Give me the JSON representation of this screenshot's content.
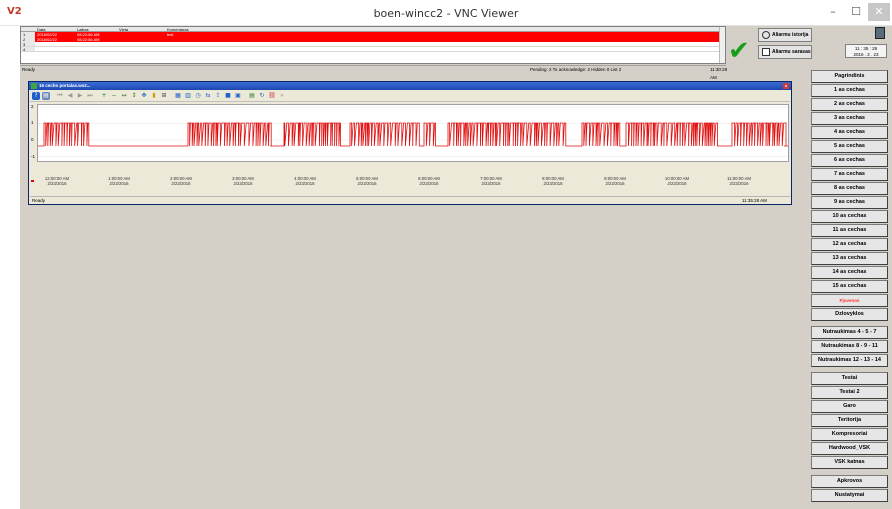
{
  "window": {
    "logo": "V2",
    "title": "boen-wincc2 - VNC Viewer",
    "min": "–",
    "max": "☐",
    "close": "✕"
  },
  "alarm_table": {
    "columns": [
      "Data",
      "Laikas",
      "Vieta",
      "Komentaras"
    ],
    "rows": [
      {
        "num": "1",
        "date": "2016/02/22",
        "time": "08:22:56 AM",
        "place": "",
        "comment": "test"
      },
      {
        "num": "2",
        "date": "2016/02/22",
        "time": "08:22:56 AM",
        "place": "",
        "comment": ""
      },
      {
        "num": "3",
        "date": "",
        "time": "",
        "place": "",
        "comment": ""
      },
      {
        "num": "4",
        "date": "",
        "time": "",
        "place": "",
        "comment": ""
      }
    ]
  },
  "alarm_status": {
    "ready": "Ready",
    "counters": "Pending: 2  To acknowledge: 2  Hidden 0  List 2",
    "time": "11:30:28 AM"
  },
  "alarm_buttons": {
    "history": "Aliarmu istorija",
    "list": "Aliarmu sarasas"
  },
  "clock": {
    "time": "11 : 35 : 29",
    "date": "2016 . 2 . 23"
  },
  "trend": {
    "title": "15 cecho portalas.ws2...",
    "y_ticks": [
      "2",
      "1",
      "0",
      "-1"
    ],
    "x_ticks": [
      {
        "t": "12:00:00 AM",
        "d": "2/23/2016"
      },
      {
        "t": "1:00:00 AM",
        "d": "2/23/2016"
      },
      {
        "t": "2:00:00 AM",
        "d": "2/23/2016"
      },
      {
        "t": "3:00:00 AM",
        "d": "2/23/2016"
      },
      {
        "t": "4:00:00 AM",
        "d": "2/23/2016"
      },
      {
        "t": "5:00:00 AM",
        "d": "2/23/2016"
      },
      {
        "t": "6:00:00 AM",
        "d": "2/23/2016"
      },
      {
        "t": "7:00:00 AM",
        "d": "2/23/2016"
      },
      {
        "t": "8:00:00 AM",
        "d": "2/23/2016"
      },
      {
        "t": "9:00:00 AM",
        "d": "2/23/2016"
      },
      {
        "t": "10:00:00 AM",
        "d": "2/23/2016"
      },
      {
        "t": "11:00:00 AM",
        "d": "2/23/2016"
      }
    ],
    "status_ready": "Ready",
    "status_time": "11:35:28 AM",
    "line_color": "#e01010"
  },
  "nav": {
    "items": [
      {
        "label": "Pagrindinis",
        "active": false
      },
      {
        "label": "1 as cechas",
        "active": false
      },
      {
        "label": "2 as cechas",
        "active": false
      },
      {
        "label": "3 as cechas",
        "active": false
      },
      {
        "label": "4 as cechas",
        "active": false
      },
      {
        "label": "5 as cechas",
        "active": false
      },
      {
        "label": "6 as cechas",
        "active": false
      },
      {
        "label": "7 as cechas",
        "active": false
      },
      {
        "label": "8 as cechas",
        "active": false
      },
      {
        "label": "9 as cechas",
        "active": false
      },
      {
        "label": "10 as cechas",
        "active": false
      },
      {
        "label": "11 as cechas",
        "active": false
      },
      {
        "label": "12 as cechas",
        "active": false
      },
      {
        "label": "13 as cechas",
        "active": false
      },
      {
        "label": "14 as cechas",
        "active": false
      },
      {
        "label": "15 as cechas",
        "active": false
      },
      {
        "label": "Pjuvenos",
        "active": true
      },
      {
        "label": "Dzlovyklos",
        "active": false
      },
      {
        "label": "Nutraukimas 4 - 5 - 7",
        "active": false
      },
      {
        "label": "Nutraukimas 8 - 9 - 11",
        "active": false
      },
      {
        "label": "Nutraukimas 12 - 13 - 14",
        "active": false
      },
      {
        "label": "Testai",
        "active": false
      },
      {
        "label": "Testai 2",
        "active": false
      },
      {
        "label": "Garo",
        "active": false
      },
      {
        "label": "Teritorija",
        "active": false
      },
      {
        "label": "Kompresoriai",
        "active": false
      },
      {
        "label": "Hardwood_VSK",
        "active": false
      },
      {
        "label": "VSK katnas",
        "active": false
      },
      {
        "label": "Apkrovos",
        "active": false
      },
      {
        "label": "Nustatymai",
        "active": false
      }
    ]
  }
}
